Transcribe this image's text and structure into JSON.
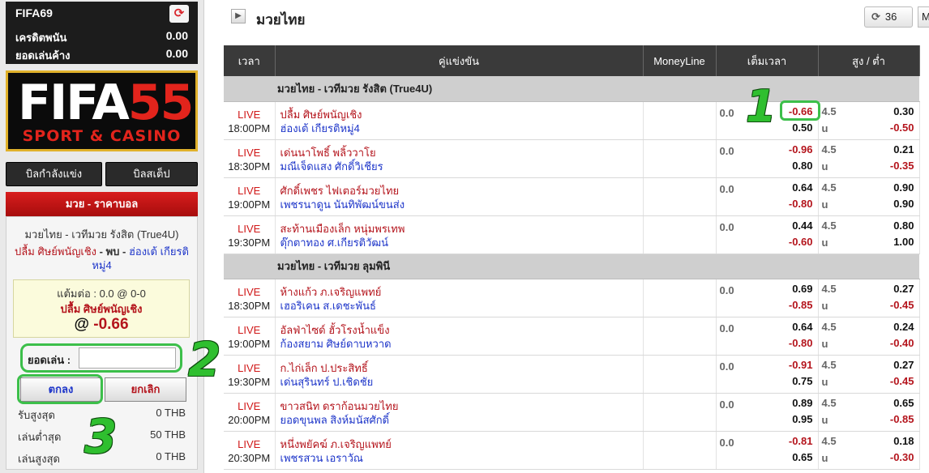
{
  "account": {
    "username": "FIFA69",
    "credit_label": "เครดิตพนัน",
    "credit_value": "0.00",
    "outstanding_label": "ยอดเล่นค้าง",
    "outstanding_value": "0.00",
    "refresh_glyph": "⟳"
  },
  "logo": {
    "part1": "FIFA",
    "part2": "55",
    "tagline": "SPORT & CASINO"
  },
  "sidebar_buttons": {
    "running": "บิลกำลังแข่ง",
    "step": "บิลสเต็ป"
  },
  "bet_slip": {
    "header": "มวย - ราคาบอล",
    "league": "มวยไทย - เวทีมวย รังสิต (True4U)",
    "home": "ปลื้ม ศิษย์พนัญเชิง",
    "vs": " - พบ - ",
    "away": "ฮ่องเต้ เกียรติหมู่4",
    "odds_line": "แต้มต่อ : 0.0 @ 0-0",
    "pick": "ปลื้ม ศิษย์พนัญเชิง",
    "at": "@ ",
    "price": "-0.66",
    "stake_label": "ยอดเล่น :",
    "stake_value": "",
    "ok": "ตกลง",
    "cancel": "ยกเลิก",
    "limits": [
      {
        "label": "รับสูงสุด",
        "value": "0 THB"
      },
      {
        "label": "เล่นต่ำสุด",
        "value": "50 THB"
      },
      {
        "label": "เล่นสูงสุด",
        "value": "0 THB"
      }
    ]
  },
  "annotations": [
    "1",
    "2",
    "3"
  ],
  "colors": {
    "accent_red": "#b4141c",
    "accent_blue": "#1d35c9",
    "highlight_green": "#3cbf4a",
    "header_dark": "#3a3a3a"
  },
  "main": {
    "title": "มวยไทย",
    "refresh_count": "36",
    "more_label": "M",
    "columns": {
      "time": "เวลา",
      "match": "คู่แข่งขัน",
      "moneyline": "MoneyLine",
      "fulltime": "เต็มเวลา",
      "ou": "สูง / ต่ำ"
    },
    "leagues": [
      {
        "name": "มวยไทย - เวทีมวย รังสิต (True4U)",
        "matches": [
          {
            "status": "LIVE",
            "time": "18:00PM",
            "home": "ปลื้ม ศิษย์พนัญเชิง",
            "away": "ฮ่องเต้ เกียรติหมู่4",
            "hdp": "0.0",
            "ft1": "-0.66",
            "ft2": "0.50",
            "ou_line": "4.5",
            "ou_u": "u",
            "ou1": "0.30",
            "ou2": "-0.50"
          },
          {
            "status": "LIVE",
            "time": "18:30PM",
            "home": "เด่นนาโพธิ์ พลิ้ววาโย",
            "away": "มณีเจ็ดแสง ศักดิ์วิเชียร",
            "hdp": "0.0",
            "ft1": "-0.96",
            "ft2": "0.80",
            "ou_line": "4.5",
            "ou_u": "u",
            "ou1": "0.21",
            "ou2": "-0.35"
          },
          {
            "status": "LIVE",
            "time": "19:00PM",
            "home": "ศักดิ์เพชร ไฟเตอร์มวยไทย",
            "away": "เพชรนาดูน นันทิพัฒน์ขนส่ง",
            "hdp": "0.0",
            "ft1": "0.64",
            "ft2": "-0.80",
            "ou_line": "4.5",
            "ou_u": "u",
            "ou1": "0.90",
            "ou2": "0.90"
          },
          {
            "status": "LIVE",
            "time": "19:30PM",
            "home": "สะท้านเมืองเล็ก หนุ่มพรเทพ",
            "away": "ตุ๊กตาทอง ศ.เกียรติวัฒน์",
            "hdp": "0.0",
            "ft1": "0.44",
            "ft2": "-0.60",
            "ou_line": "4.5",
            "ou_u": "u",
            "ou1": "0.80",
            "ou2": "1.00"
          }
        ]
      },
      {
        "name": "มวยไทย - เวทีมวย ลุมพินี",
        "matches": [
          {
            "status": "LIVE",
            "time": "18:30PM",
            "home": "ห้างแก้ว ภ.เจริญแพทย์",
            "away": "เฮอริเคน ส.เดชะพันธ์",
            "hdp": "0.0",
            "ft1": "0.69",
            "ft2": "-0.85",
            "ou_line": "4.5",
            "ou_u": "u",
            "ou1": "0.27",
            "ou2": "-0.45"
          },
          {
            "status": "LIVE",
            "time": "19:00PM",
            "home": "อัลฟ่าไซด์ ฮั้วโรงน้ำแข็ง",
            "away": "ก้องสยาม ศิษย์ดาบหวาด",
            "hdp": "0.0",
            "ft1": "0.64",
            "ft2": "-0.80",
            "ou_line": "4.5",
            "ou_u": "u",
            "ou1": "0.24",
            "ou2": "-0.40"
          },
          {
            "status": "LIVE",
            "time": "19:30PM",
            "home": "ก.ไก่เล็ก ป.ประสิทธิ์",
            "away": "เด่นสุรินทร์ ป.เชิดชัย",
            "hdp": "0.0",
            "ft1": "-0.91",
            "ft2": "0.75",
            "ou_line": "4.5",
            "ou_u": "u",
            "ou1": "0.27",
            "ou2": "-0.45"
          },
          {
            "status": "LIVE",
            "time": "20:00PM",
            "home": "ขาวสนิท ดราก้อนมวยไทย",
            "away": "ยอดขุนพล สิงห์มนัสศักดิ์",
            "hdp": "0.0",
            "ft1": "0.89",
            "ft2": "0.95",
            "ou_line": "4.5",
            "ou_u": "u",
            "ou1": "0.65",
            "ou2": "-0.85"
          },
          {
            "status": "LIVE",
            "time": "20:30PM",
            "home": "หนึ่งพยัคฆ์ ภ.เจริญแพทย์",
            "away": "เพชรสวน เอราวัณ",
            "hdp": "0.0",
            "ft1": "-0.81",
            "ft2": "0.65",
            "ou_line": "4.5",
            "ou_u": "u",
            "ou1": "0.18",
            "ou2": "-0.30"
          }
        ]
      }
    ]
  }
}
